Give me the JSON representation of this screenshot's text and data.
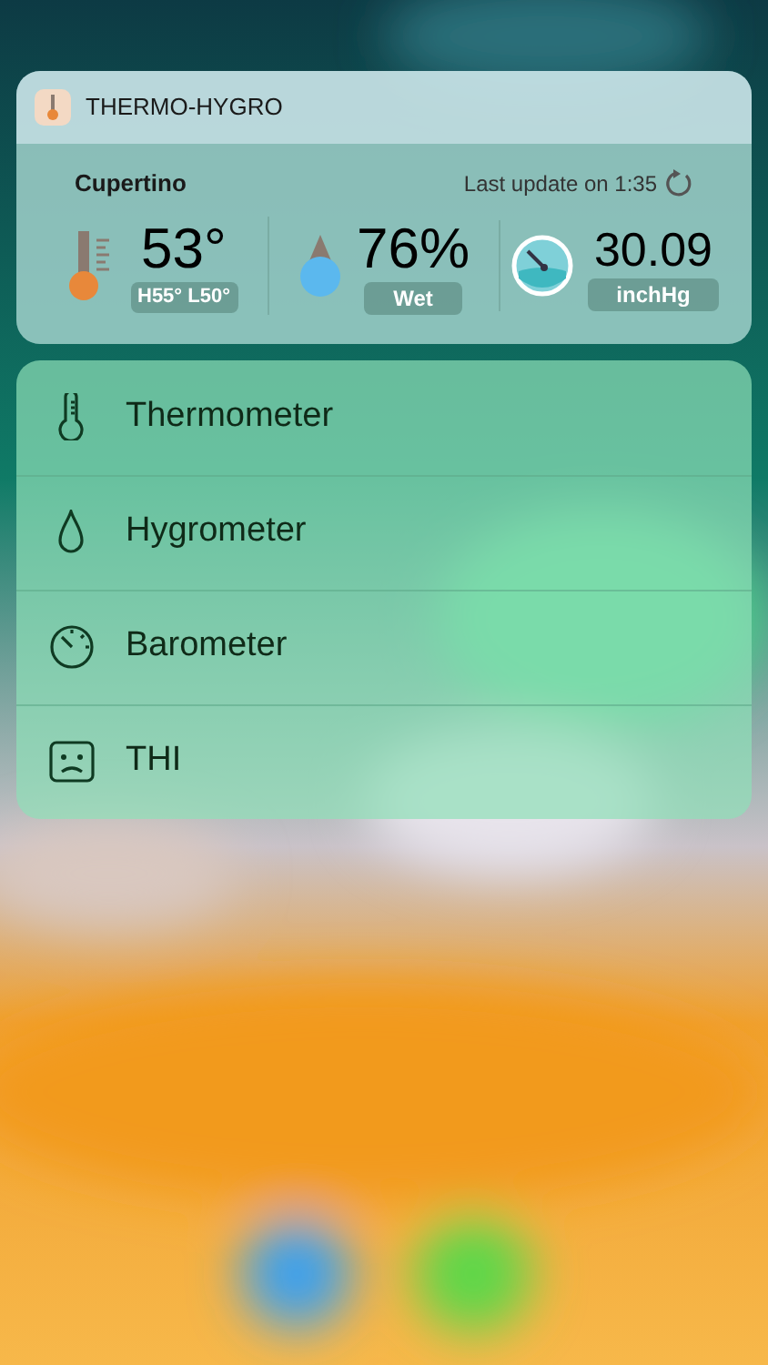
{
  "widget": {
    "title": "THERMO-HYGRO",
    "location": "Cupertino",
    "last_update": "Last update on 1:35",
    "readings": [
      {
        "kind": "temperature",
        "value": "53°",
        "high": "H55°",
        "low": "L50°"
      },
      {
        "kind": "humidity",
        "value": "76%",
        "label": "Wet"
      },
      {
        "kind": "pressure",
        "value": "30.09",
        "label": "inchHg"
      }
    ]
  },
  "menu": [
    {
      "kind": "thermometer",
      "label": "Thermometer"
    },
    {
      "kind": "drop",
      "label": "Hygrometer"
    },
    {
      "kind": "gauge",
      "label": "Barometer"
    },
    {
      "kind": "face",
      "label": "THI"
    }
  ]
}
